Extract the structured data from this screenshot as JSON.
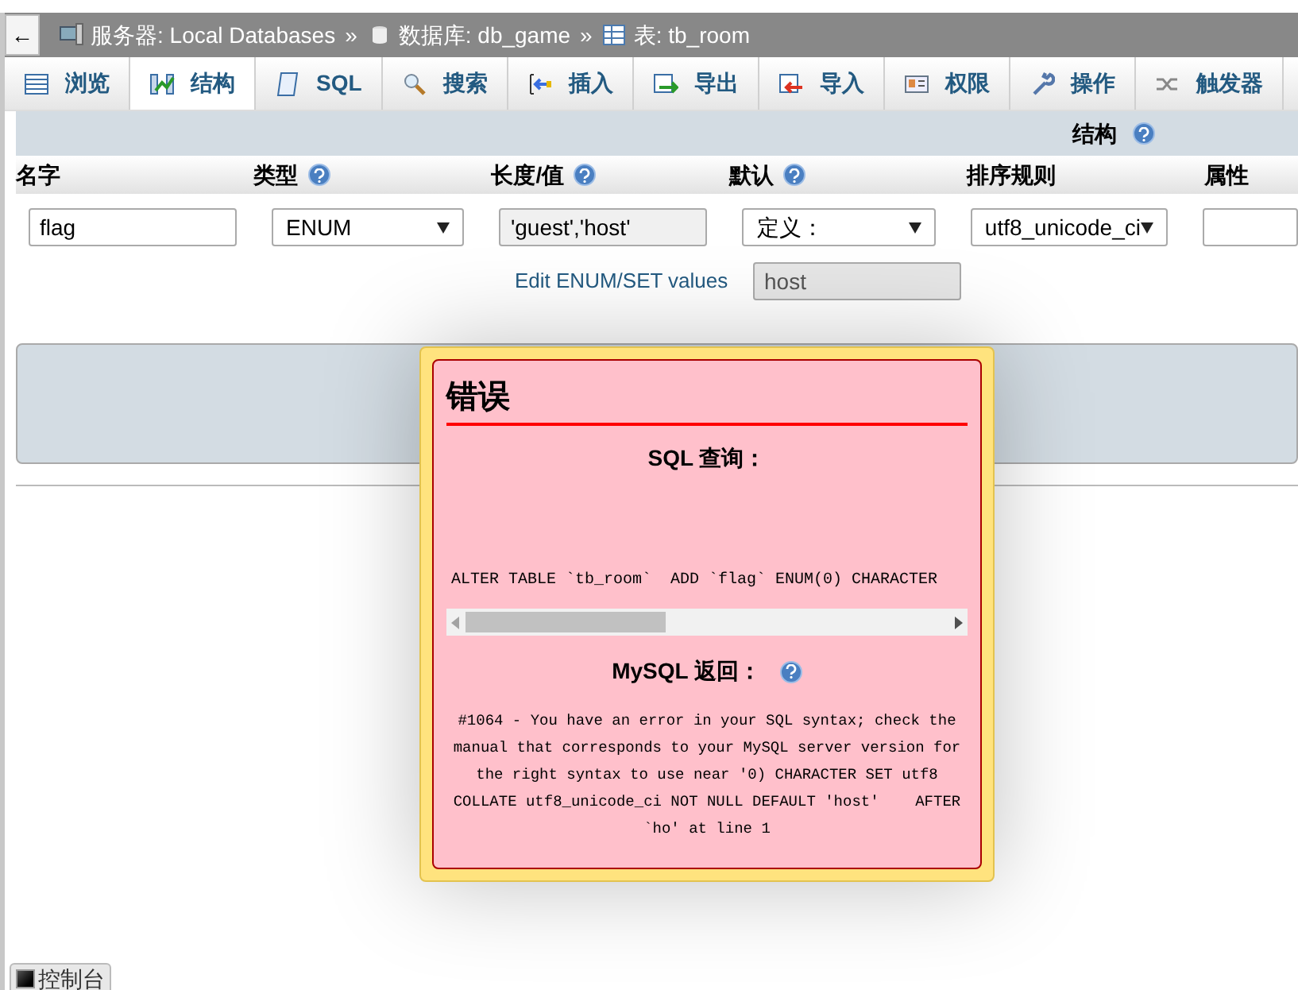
{
  "breadcrumb": {
    "back": "←",
    "items": [
      {
        "kind": "server",
        "text": "服务器: Local Databases"
      },
      {
        "kind": "database",
        "text": "数据库: db_game"
      },
      {
        "kind": "table",
        "text": "表: tb_room"
      }
    ],
    "separator": "»"
  },
  "tabs": [
    {
      "kind": "browse",
      "label": "浏览",
      "selected": false
    },
    {
      "kind": "structure",
      "label": "结构",
      "selected": true
    },
    {
      "kind": "sql",
      "label": "SQL",
      "selected": false
    },
    {
      "kind": "search",
      "label": "搜索",
      "selected": false
    },
    {
      "kind": "insert",
      "label": "插入",
      "selected": false
    },
    {
      "kind": "export",
      "label": "导出",
      "selected": false
    },
    {
      "kind": "import",
      "label": "导入",
      "selected": false
    },
    {
      "kind": "privileges",
      "label": "权限",
      "selected": false
    },
    {
      "kind": "operations",
      "label": "操作",
      "selected": false
    },
    {
      "kind": "triggers",
      "label": "触发器",
      "selected": false
    }
  ],
  "section_title": "结构",
  "columns": [
    {
      "label": "名字",
      "help": false
    },
    {
      "label": "类型",
      "help": true
    },
    {
      "label": "长度/值",
      "help": true
    },
    {
      "label": "默认",
      "help": true
    },
    {
      "label": "排序规则",
      "help": false
    },
    {
      "label": "属性",
      "help": false
    }
  ],
  "field": {
    "name": "flag",
    "type": "ENUM",
    "length": "'guest','host'",
    "default": "定义：",
    "collation": "utf8_unicode_ci",
    "enum_link": "Edit ENUM/SET values",
    "default_value": "host"
  },
  "error_dialog": {
    "title": "错误",
    "sql_heading": "SQL 查询：",
    "query": "ALTER TABLE `tb_room`  ADD `flag` ENUM(0) CHARACTER",
    "mysql_heading": "MySQL 返回：",
    "message": "#1064 - You have an error in your SQL syntax; check the manual that corresponds to your MySQL server version for the right syntax to use near '0) CHARACTER SET utf8 COLLATE utf8_unicode_ci NOT NULL DEFAULT 'host'    AFTER `ho' at line 1"
  },
  "console": {
    "label": "控制台"
  }
}
